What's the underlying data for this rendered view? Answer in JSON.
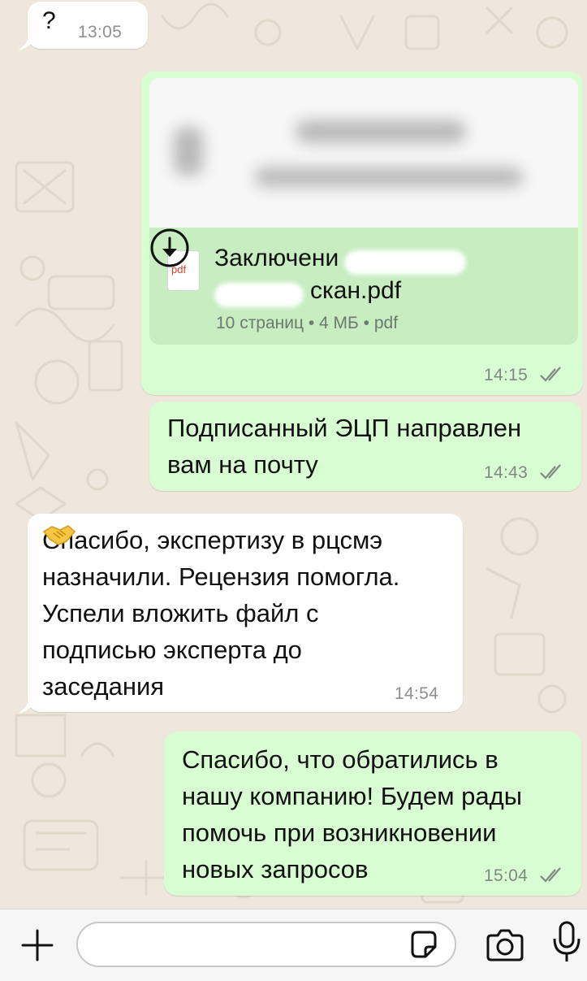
{
  "messages": [
    {
      "id": "m1",
      "direction": "incoming",
      "text": "?",
      "time": "13:05"
    },
    {
      "id": "m2",
      "direction": "outgoing",
      "type": "document",
      "document": {
        "name": "Заключени… скан.pdf",
        "name_line1": "Заключени",
        "name_line2": "скан.pdf",
        "type_badge": "pdf",
        "meta": "10 страниц • 4 МБ • pdf"
      },
      "time": "14:15",
      "status": "read"
    },
    {
      "id": "m3",
      "direction": "outgoing",
      "text": "Подписанный ЭЦП направлен\nвам на почту",
      "time": "14:43",
      "status": "read"
    },
    {
      "id": "m4",
      "direction": "incoming",
      "text": "Спасибо, экспертизу в рцсмэ\nназначили. Рецензия помогла.\nУспели вложить файл с\nподписью эксперта до\nзаседания",
      "emoji": "handshake",
      "time": "14:54"
    },
    {
      "id": "m5",
      "direction": "outgoing",
      "text": "Спасибо, что обратились в\nнашу компанию! Будем рады\nпомочь при возникновении\nновых запросов",
      "time": "15:04",
      "status": "read"
    }
  ],
  "input_bar": {
    "placeholder": "",
    "icons": [
      "plus-icon",
      "sticker-icon",
      "camera-icon",
      "microphone-icon"
    ]
  },
  "colors": {
    "chat_background": "#EFE7DC",
    "incoming_bubble": "#FFFFFF",
    "outgoing_bubble": "#D9FDD3",
    "read_ticks": "#7C8A80"
  }
}
